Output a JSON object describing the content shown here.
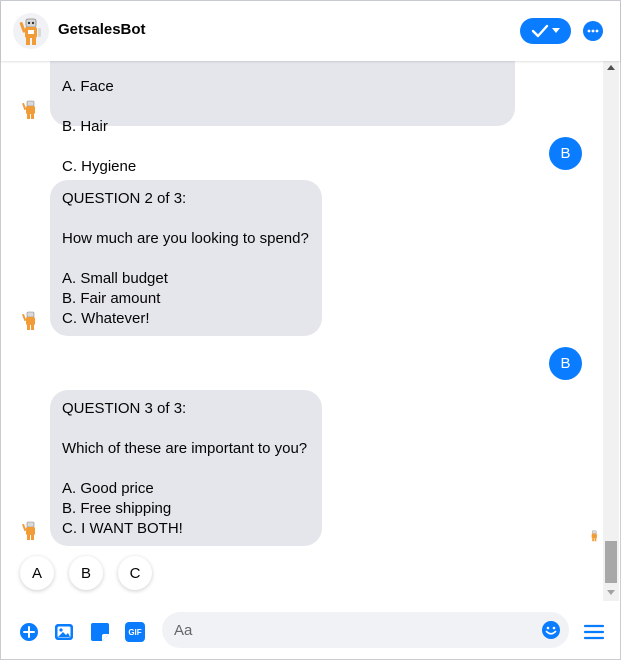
{
  "header": {
    "title": "GetsalesBot",
    "avatar_icon": "robot-avatar-icon",
    "actions": [
      "check-dropdown-icon",
      "more-options-icon"
    ]
  },
  "messages": {
    "bubble1": {
      "lines": [
        "A. Face",
        "B. Hair",
        "C. Hygiene"
      ]
    },
    "reply1": "B",
    "bubble2": {
      "text": "QUESTION 2 of 3:\n\nHow much are you looking to spend?\n\nA. Small budget\nB. Fair amount\nC. Whatever!"
    },
    "reply2": "B",
    "bubble3": {
      "text": "QUESTION 3 of 3:\n\nWhich of these are important to you?\n\nA. Good price\nB. Free shipping\nC. I WANT BOTH!"
    }
  },
  "quick_replies": [
    "A",
    "B",
    "C"
  ],
  "composer": {
    "placeholder": "Aa",
    "tools": [
      "plus-icon",
      "photo-icon",
      "sticker-icon",
      "gif-icon"
    ],
    "gif_label": "GIF",
    "emoji_icon": "emoji-icon",
    "menu_icon": "menu-icon"
  },
  "colors": {
    "accent": "#0a7cff",
    "bubble_bg": "#e4e6eb",
    "input_bg": "#f0f2f5"
  }
}
